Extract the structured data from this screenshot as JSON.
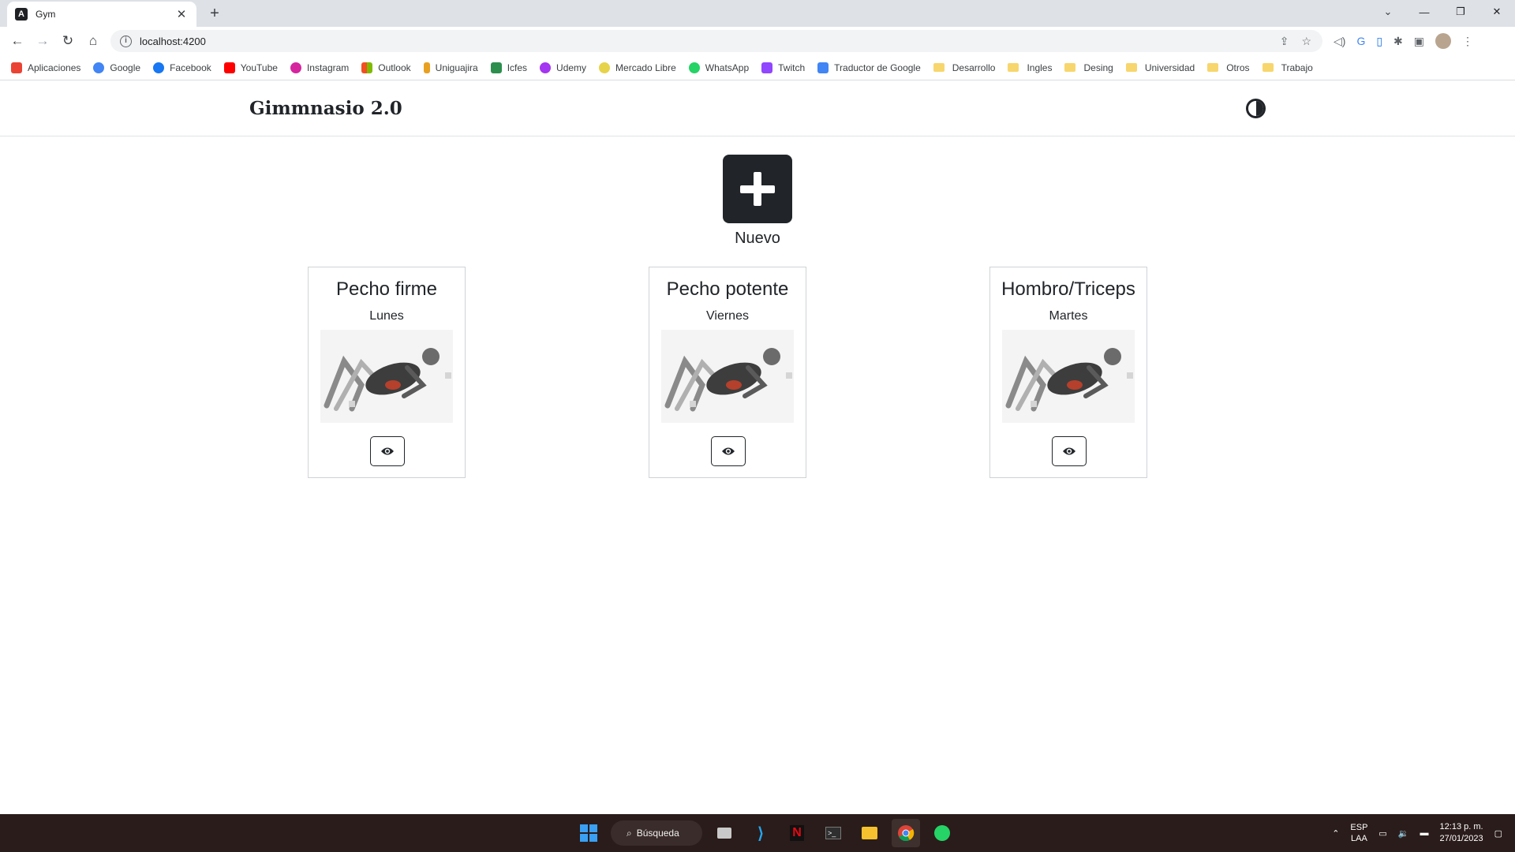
{
  "browser": {
    "tab": {
      "title": "Gym",
      "favicon": "angular-icon"
    },
    "url": "localhost:4200",
    "bookmarks": [
      {
        "label": "Aplicaciones",
        "icon": "apps-grid-icon",
        "color": "#ea4335"
      },
      {
        "label": "Google",
        "icon": "google-icon",
        "color": "#4285f4"
      },
      {
        "label": "Facebook",
        "icon": "facebook-icon",
        "color": "#1877f2"
      },
      {
        "label": "YouTube",
        "icon": "youtube-icon",
        "color": "#ff0000"
      },
      {
        "label": "Instagram",
        "icon": "instagram-icon",
        "color": "#d6249f"
      },
      {
        "label": "Outlook",
        "icon": "microsoft-icon",
        "color": "#f25022"
      },
      {
        "label": "Uniguajira",
        "icon": "uniguajira-icon",
        "color": "#e8a020"
      },
      {
        "label": "Icfes",
        "icon": "icfes-icon",
        "color": "#2d8f4e"
      },
      {
        "label": "Udemy",
        "icon": "udemy-icon",
        "color": "#a435f0"
      },
      {
        "label": "Mercado Libre",
        "icon": "mercado-libre-icon",
        "color": "#fff159"
      },
      {
        "label": "WhatsApp",
        "icon": "whatsapp-icon",
        "color": "#25d366"
      },
      {
        "label": "Twitch",
        "icon": "twitch-icon",
        "color": "#9146ff"
      },
      {
        "label": "Traductor de Google",
        "icon": "google-translate-icon",
        "color": "#4285f4"
      }
    ],
    "folders": [
      "Desarrollo",
      "Ingles",
      "Desing",
      "Universidad",
      "Otros",
      "Trabajo"
    ]
  },
  "app": {
    "brand": "Gimmnasio 2.0",
    "new_label": "Nuevo",
    "routines": [
      {
        "name": "Pecho firme",
        "day": "Lunes"
      },
      {
        "name": "Pecho potente",
        "day": "Viernes"
      },
      {
        "name": "Hombro/Triceps",
        "day": "Martes"
      }
    ]
  },
  "taskbar": {
    "search_label": "Búsqueda",
    "lang_top": "ESP",
    "lang_bottom": "LAA",
    "time": "12:13 p. m.",
    "date": "27/01/2023"
  }
}
